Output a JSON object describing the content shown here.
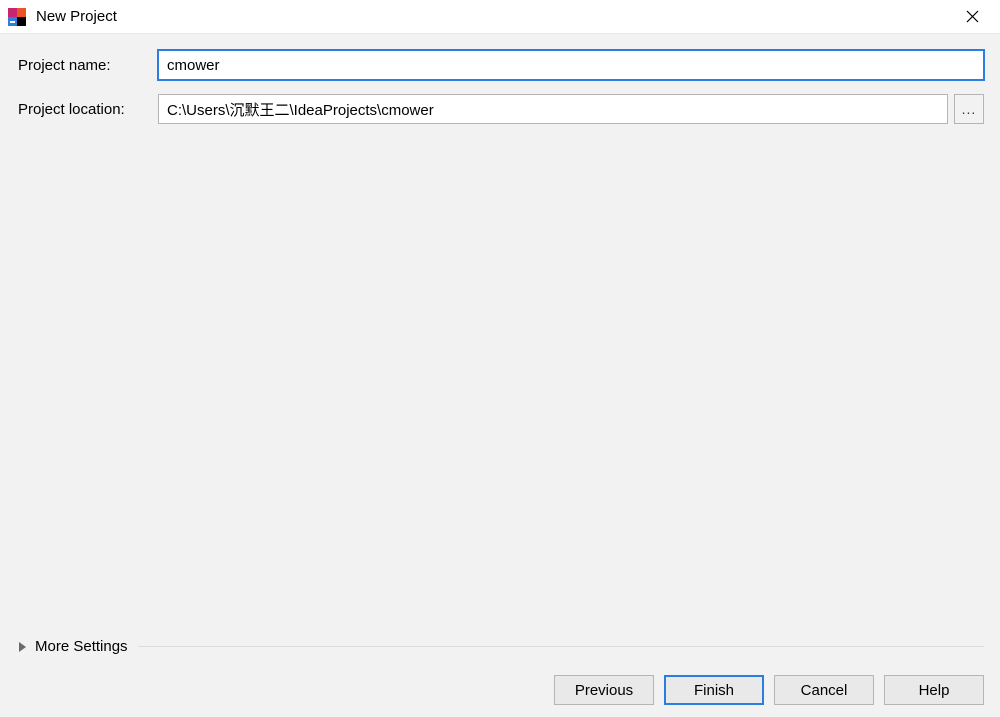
{
  "window": {
    "title": "New Project"
  },
  "form": {
    "projectName": {
      "label": "Project name:",
      "value": "cmower"
    },
    "projectLocation": {
      "label": "Project location:",
      "value": "C:\\Users\\沉默王二\\IdeaProjects\\cmower",
      "browseLabel": "..."
    }
  },
  "moreSettings": {
    "label": "More Settings"
  },
  "buttons": {
    "previous": "Previous",
    "finish": "Finish",
    "cancel": "Cancel",
    "help": "Help"
  }
}
